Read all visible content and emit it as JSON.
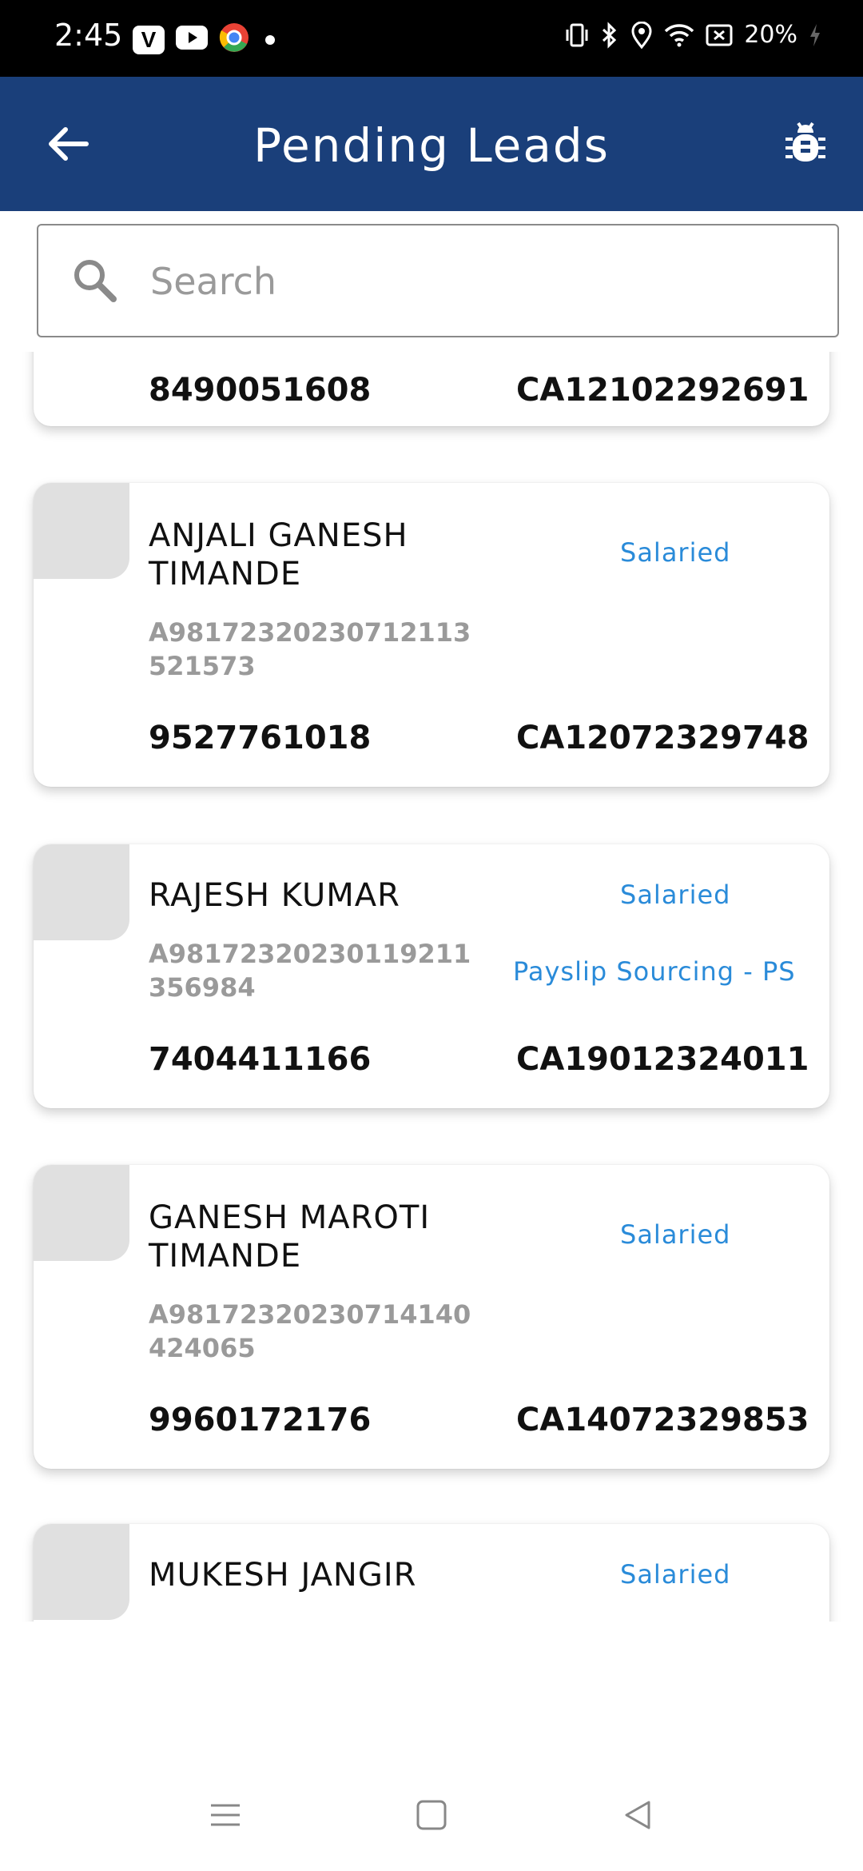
{
  "status_bar": {
    "time": "2:45",
    "battery": "20%",
    "app_icons": [
      "v-app-icon",
      "youtube-icon",
      "chrome-icon"
    ]
  },
  "header": {
    "title": "Pending Leads"
  },
  "search": {
    "placeholder": "Search",
    "value": ""
  },
  "leads": [
    {
      "name": "",
      "app_id": "",
      "tags": [],
      "mobile": "8490051608",
      "customer_id": "CA12102292691"
    },
    {
      "name": "ANJALI GANESH TIMANDE",
      "app_id": "A98172320230712113521573",
      "tags": [
        "Salaried"
      ],
      "mobile": "9527761018",
      "customer_id": "CA12072329748"
    },
    {
      "name": "RAJESH KUMAR",
      "app_id": "A98172320230119211356984",
      "tags": [
        "Salaried",
        "Payslip Sourcing - PS"
      ],
      "mobile": "7404411166",
      "customer_id": "CA19012324011"
    },
    {
      "name": "GANESH MAROTI TIMANDE",
      "app_id": "A98172320230714140424065",
      "tags": [
        "Salaried"
      ],
      "mobile": "9960172176",
      "customer_id": "CA14072329853"
    },
    {
      "name": "MUKESH JANGIR",
      "app_id": "",
      "tags": [
        "Salaried"
      ],
      "mobile": "",
      "customer_id": ""
    }
  ],
  "colors": {
    "app_bar": "#1a3f7a",
    "tag": "#2a8bd9",
    "avatar_placeholder": "#e0e0e0"
  }
}
